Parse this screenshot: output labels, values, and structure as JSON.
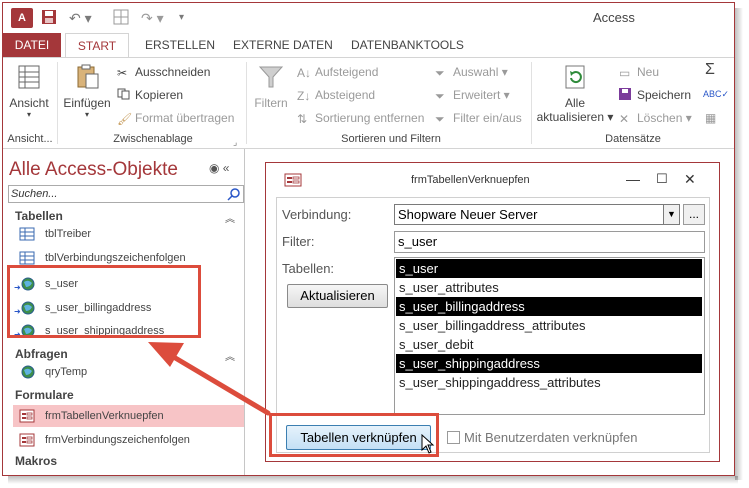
{
  "window": {
    "app_title": "Access",
    "app_icon_text": "A"
  },
  "ribbon_tabs": [
    "DATEI",
    "START",
    "ERSTELLEN",
    "EXTERNE DATEN",
    "DATENBANKTOOLS"
  ],
  "ribbon": {
    "ansicht": {
      "label": "Ansicht",
      "group": "Ansicht..."
    },
    "zwischenablage": {
      "einfuegen": "Einfügen",
      "ausschneiden": "Ausschneiden",
      "kopieren": "Kopieren",
      "format": "Format übertragen",
      "group": "Zwischenablage"
    },
    "sortieren": {
      "filtern": "Filtern",
      "aufsteigend": "Aufsteigend",
      "absteigend": "Absteigend",
      "entfernen": "Sortierung entfernen",
      "auswahl": "Auswahl",
      "erweitert": "Erweitert",
      "filter_ein_aus": "Filter ein/aus",
      "group": "Sortieren und Filtern"
    },
    "datensaetze": {
      "alle": "Alle",
      "aktualisieren": "aktualisieren",
      "neu": "Neu",
      "speichern": "Speichern",
      "loeschen": "Löschen",
      "group": "Datensätze"
    }
  },
  "nav": {
    "title": "Alle Access-Objekte",
    "search_placeholder": "Suchen...",
    "categories": {
      "tabellen": "Tabellen",
      "abfragen": "Abfragen",
      "formulare": "Formulare",
      "makros": "Makros"
    },
    "tabellen_items": [
      "tblTreiber",
      "tblVerbindungszeichenfolgen",
      "s_user",
      "s_user_billingaddress",
      "s_user_shippingaddress"
    ],
    "abfragen_items": [
      "qryTemp"
    ],
    "formulare_items": [
      "frmTabellenVerknuepfen",
      "frmVerbindungszeichenfolgen"
    ]
  },
  "form": {
    "title": "frmTabellenVerknuepfen",
    "verbindung_label": "Verbindung:",
    "verbindung_value": "Shopware Neuer Server",
    "ellipsis": "...",
    "filter_label": "Filter:",
    "filter_value": "s_user",
    "tabellen_label": "Tabellen:",
    "aktualisieren_button": "Aktualisieren",
    "tables": [
      {
        "name": "s_user",
        "selected": true
      },
      {
        "name": "s_user_attributes",
        "selected": false
      },
      {
        "name": "s_user_billingaddress",
        "selected": true
      },
      {
        "name": "s_user_billingaddress_attributes",
        "selected": false
      },
      {
        "name": "s_user_debit",
        "selected": false
      },
      {
        "name": "s_user_shippingaddress",
        "selected": true
      },
      {
        "name": "s_user_shippingaddress_attributes",
        "selected": false
      }
    ],
    "verknuepfen_button": "Tabellen verknüpfen",
    "benutzerdaten_checkbox": "Mit Benutzerdaten verknüpfen"
  },
  "colors": {
    "accent": "#a4373a",
    "highlight": "#dc4c3c",
    "nav_selected": "#f7c4c6"
  }
}
